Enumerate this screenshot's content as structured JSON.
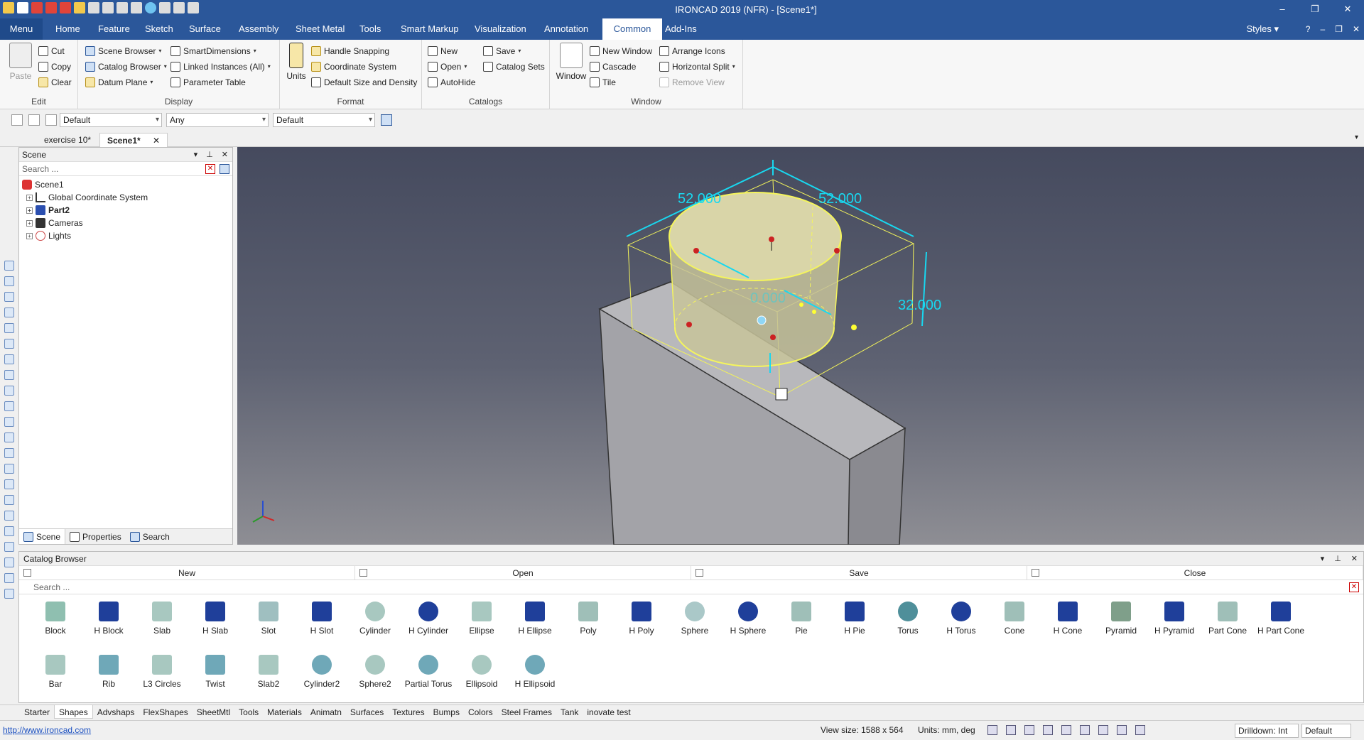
{
  "app": {
    "title": "IRONCAD 2019 (NFR) - [Scene1*]"
  },
  "tabs": [
    "Menu",
    "Home",
    "Feature",
    "Sketch",
    "Surface",
    "Assembly",
    "Sheet Metal",
    "Tools",
    "Smart Markup",
    "Visualization",
    "Annotation",
    "Common",
    "Add-Ins"
  ],
  "active_tab": "Common",
  "styles_label": "Styles",
  "ribbon": {
    "edit": {
      "paste": "Paste",
      "cut": "Cut",
      "copy": "Copy",
      "clear": "Clear",
      "label": "Edit"
    },
    "display": {
      "scene_browser": "Scene Browser",
      "catalog_browser": "Catalog Browser",
      "datum_plane": "Datum Plane",
      "smart_dimensions": "SmartDimensions",
      "linked_instances": "Linked Instances (All)",
      "parameter_table": "Parameter Table",
      "label": "Display"
    },
    "format": {
      "units": "Units",
      "handle_snapping": "Handle Snapping",
      "coordinate_system": "Coordinate System",
      "default_size": "Default Size and Density",
      "label": "Format"
    },
    "catalogs": {
      "new": "New",
      "open": "Open",
      "autohide": "AutoHide",
      "save": "Save",
      "catalog_sets": "Catalog Sets",
      "label": "Catalogs"
    },
    "window": {
      "window": "Window",
      "new_window": "New Window",
      "cascade": "Cascade",
      "tile": "Tile",
      "arrange_icons": "Arrange Icons",
      "horizontal_split": "Horizontal Split",
      "remove_view": "Remove View",
      "label": "Window"
    }
  },
  "toolbar2": {
    "combo1": "Default",
    "combo2": "Any",
    "combo3": "Default"
  },
  "doc_tabs": [
    "exercise 10*",
    "Scene1*"
  ],
  "scene_panel": {
    "title": "Scene",
    "search_placeholder": "Search ...",
    "tree": [
      "Scene1",
      "Global Coordinate System",
      "Part2",
      "Cameras",
      "Lights"
    ],
    "tabs": [
      "Scene",
      "Properties",
      "Search"
    ]
  },
  "viewport": {
    "dims": [
      "52.000",
      "52.000",
      "32.000",
      "0.000"
    ]
  },
  "catalog": {
    "title": "Catalog Browser",
    "buttons": [
      "New",
      "Open",
      "Save",
      "Close"
    ],
    "search_placeholder": "Search ...",
    "row1": [
      "Block",
      "H Block",
      "Slab",
      "H Slab",
      "Slot",
      "H Slot",
      "Cylinder",
      "H Cylinder",
      "Ellipse",
      "H Ellipse",
      "Poly",
      "H Poly",
      "Sphere",
      "H Sphere",
      "Pie",
      "H Pie",
      "Torus",
      "H Torus",
      "Cone",
      "H Cone",
      "Pyramid",
      "H Pyramid",
      "Part Cone",
      "H Part Cone"
    ],
    "row2": [
      "Bar",
      "Rib",
      "L3 Circles",
      "Twist",
      "Slab2",
      "Cylinder2",
      "Sphere2",
      "Partial Torus",
      "Ellipsoid",
      "H Ellipsoid"
    ],
    "tabs": [
      "Starter",
      "Shapes",
      "Advshaps",
      "FlexShapes",
      "SheetMtl",
      "Tools",
      "Materials",
      "Animatn",
      "Surfaces",
      "Textures",
      "Bumps",
      "Colors",
      "Steel Frames",
      "Tank",
      "inovate test"
    ],
    "active_tab": "Shapes"
  },
  "status": {
    "link": "http://www.ironcad.com",
    "view_size": "View size: 1588 x  564",
    "units": "Units: mm, deg",
    "drilldown": "Drilldown: Int",
    "default": "Default"
  },
  "colors": {
    "accent": "#2b579a",
    "dimension": "#18d8f0",
    "selection": "#f2f25a"
  }
}
